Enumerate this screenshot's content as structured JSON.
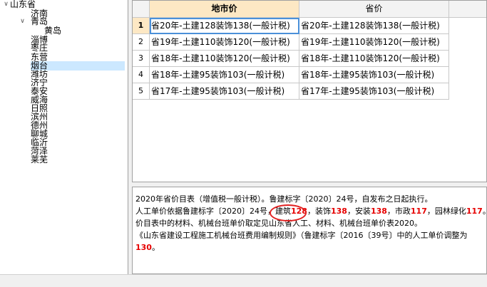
{
  "tree": {
    "root": "山东省",
    "items": [
      {
        "label": "济南",
        "level": 1
      },
      {
        "label": "青岛",
        "level": 1,
        "expanded": true
      },
      {
        "label": "黄岛",
        "level": 2
      },
      {
        "label": "淄博",
        "level": 1
      },
      {
        "label": "枣庄",
        "level": 1
      },
      {
        "label": "东营",
        "level": 1
      },
      {
        "label": "烟台",
        "level": 1,
        "selected": true
      },
      {
        "label": "潍坊",
        "level": 1
      },
      {
        "label": "济宁",
        "level": 1
      },
      {
        "label": "泰安",
        "level": 1
      },
      {
        "label": "威海",
        "level": 1
      },
      {
        "label": "日照",
        "level": 1
      },
      {
        "label": "滨州",
        "level": 1
      },
      {
        "label": "德州",
        "level": 1
      },
      {
        "label": "聊城",
        "level": 1
      },
      {
        "label": "临沂",
        "level": 1
      },
      {
        "label": "菏泽",
        "level": 1
      },
      {
        "label": "莱芜",
        "level": 1
      }
    ]
  },
  "grid": {
    "columns": [
      "地市价",
      "省价"
    ],
    "rows": [
      {
        "num": "1",
        "local": "省20年-土建128装饰138(一般计税)",
        "province": "省20年-土建128装饰138(一般计税)"
      },
      {
        "num": "2",
        "local": "省19年-土建110装饰120(一般计税)",
        "province": "省19年-土建110装饰120(一般计税)"
      },
      {
        "num": "3",
        "local": "省18年-土建110装饰120(一般计税)",
        "province": "省18年-土建110装饰120(一般计税)"
      },
      {
        "num": "4",
        "local": "省18年-土建95装饰103(一般计税)",
        "province": "省18年-土建95装饰103(一般计税)"
      },
      {
        "num": "5",
        "local": "省17年-土建95装饰103(一般计税)",
        "province": "省17年-土建95装饰103(一般计税)"
      }
    ]
  },
  "description": {
    "line1": "2020年省价目表（增值税一般计税）。鲁建标字〔2020〕24号，自发布之日起执行。",
    "line2_prefix": "人工单价依据鲁建标字〔2020〕24号，",
    "line2_item1_label": "建筑",
    "line2_item1_value": "128",
    "line2_item2_label": "装饰",
    "line2_item2_value": "138",
    "line2_item3_label": "安装",
    "line2_item3_value": "138",
    "line2_item4_label": "市政",
    "line2_item4_value": "117",
    "line2_item5_label": "园林绿化",
    "line2_item5_value": "117",
    "line3": "价目表中的材料、机械台班单价取定见山东省人工、材料、机械台班单价表2020。",
    "line4": "《山东省建设工程施工机械台班费用编制规则》（鲁建标字〔2016〔39号〕中的人工单价调整为",
    "line5_value": "130",
    "line5_suffix": "。"
  },
  "colors": {
    "header_active": "#fde8c4",
    "selected_tree": "#cce8ff",
    "highlight_red": "#e60000"
  }
}
